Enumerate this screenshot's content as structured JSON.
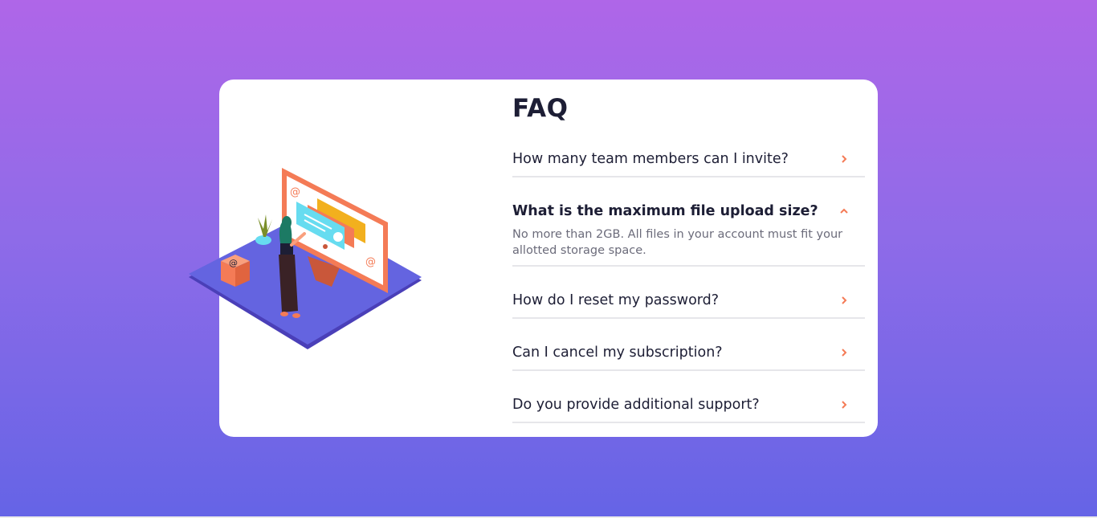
{
  "page": {
    "background_top": "#af66e8",
    "background_bottom": "#6564e6"
  },
  "illustration": {
    "icon": "woman-at-monitor-illustration"
  },
  "faq": {
    "title": "FAQ",
    "accent_color": "#f47b56",
    "items": [
      {
        "question": "How many team members can I invite?",
        "expanded": false
      },
      {
        "question": "What is the maximum file upload size?",
        "answer": "No more than 2GB. All files in your account must fit your allotted storage space.",
        "expanded": true
      },
      {
        "question": "How do I reset my password?",
        "expanded": false
      },
      {
        "question": "Can I cancel my subscription?",
        "expanded": false
      },
      {
        "question": "Do you provide additional support?",
        "expanded": false
      }
    ]
  }
}
